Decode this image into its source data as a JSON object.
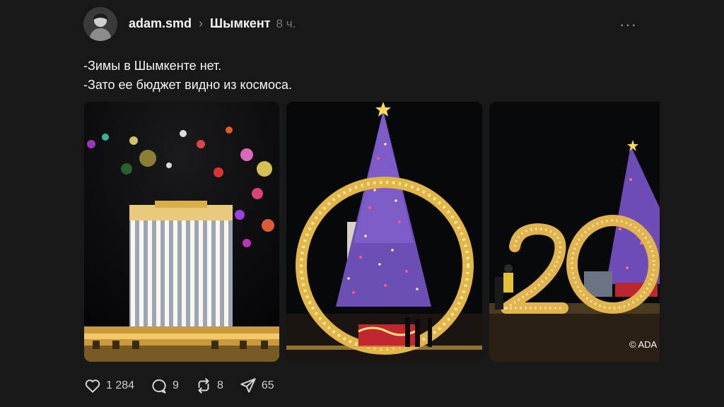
{
  "post": {
    "username": "adam.smd",
    "location": "Шымкент",
    "time": "8 ч.",
    "lines": [
      "-Зимы в Шымкенте нет.",
      "-Зато ее бюджет видно из космоса."
    ],
    "watermark": "© ADA",
    "photos": [
      {
        "subject": "city-administration-building-night"
      },
      {
        "subject": "christmas-tree-golden-ring"
      },
      {
        "subject": "light-figures-2025"
      }
    ],
    "actions": {
      "likes": "1 284",
      "comments": "9",
      "reposts": "8",
      "shares": "65"
    },
    "icons": {
      "like": "heart-icon",
      "comment": "comment-icon",
      "repost": "repost-icon",
      "share": "send-icon",
      "more": "more-icon"
    }
  }
}
